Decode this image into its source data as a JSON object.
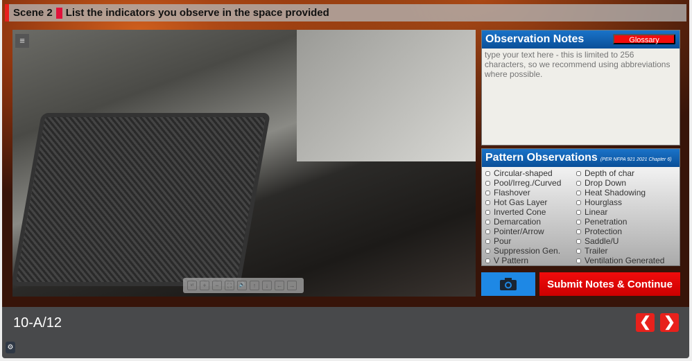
{
  "header": {
    "scene": "Scene 2",
    "instruction": "List the indicators you observe in the space provided"
  },
  "viewer": {
    "menu_icon": "hamburger-icon",
    "controls": [
      "vr",
      "+",
      "−",
      "⛶",
      "🔊",
      "↑",
      "↓",
      "←",
      "→"
    ]
  },
  "notes": {
    "title": "Observation Notes",
    "glossary": "Glossary",
    "placeholder": "type your text here - this is limited to 256 characters, so we recommend using abbreviations where possible."
  },
  "pattern": {
    "title": "Pattern Observations",
    "subtitle": "(PER NFPA 921 2021 Chapter 6)",
    "items": [
      "Circular-shaped",
      "Depth of char",
      "Pool/Irreg./Curved",
      "Drop Down",
      "Flashover",
      "Heat Shadowing",
      "Hot Gas Layer",
      "Hourglass",
      "Inverted Cone",
      "Linear",
      "Demarcation",
      "Penetration",
      "Pointer/Arrow",
      "Protection",
      "Pour",
      "Saddle/U",
      "Suppression Gen.",
      "Trailer",
      "V Pattern",
      "Ventilation Generated"
    ]
  },
  "actions": {
    "submit": "Submit Notes & Continue"
  },
  "footer": {
    "slide": "10-A/12",
    "prev": "❮",
    "next": "❯"
  }
}
